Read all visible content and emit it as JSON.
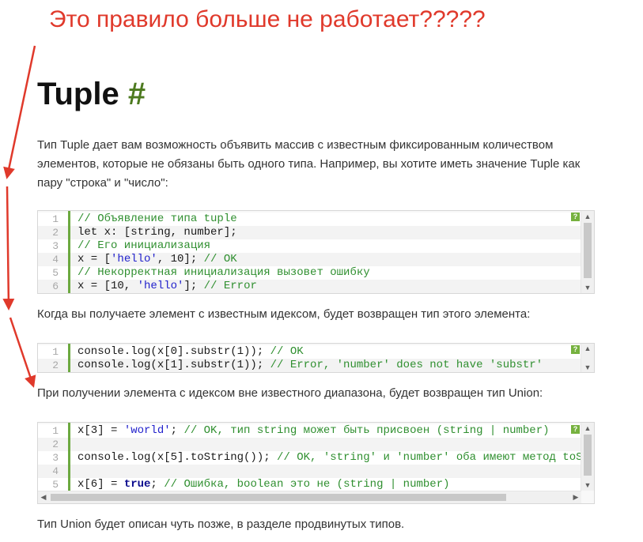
{
  "annotation": {
    "text": "Это правило больше не работает?????",
    "color": "#e0392b"
  },
  "heading": {
    "title": "Tuple",
    "anchor": "#"
  },
  "paragraphs": {
    "intro": "Тип Tuple дает вам возможность объявить массив с известным фиксированным количеством элементов, которые не обязаны быть одного типа. Например, вы хотите иметь значение Tuple как пару \"строка\" и \"число\":",
    "known_index": "Когда вы получаете элемент с известным идексом, будет возвращен тип этого элемента:",
    "out_of_range": "При получении элемента с идексом вне известного диапазона, будет возвращен тип Union:",
    "union_note": "Тип Union будет описан чуть позже, в разделе продвинутых типов."
  },
  "code_blocks": {
    "block1": {
      "lines": [
        {
          "num": "1",
          "tokens": [
            {
              "t": "// Объявление типа tuple",
              "c": "cmt"
            }
          ]
        },
        {
          "num": "2",
          "tokens": [
            {
              "t": "let x: [string, number];",
              "c": ""
            }
          ]
        },
        {
          "num": "3",
          "tokens": [
            {
              "t": "// Его инициализация",
              "c": "cmt"
            }
          ]
        },
        {
          "num": "4",
          "tokens": [
            {
              "t": "x = [",
              "c": ""
            },
            {
              "t": "'hello'",
              "c": "str"
            },
            {
              "t": ", 10]; ",
              "c": ""
            },
            {
              "t": "// OK",
              "c": "cmt"
            }
          ]
        },
        {
          "num": "5",
          "tokens": [
            {
              "t": "// Некорректная инициализация вызовет ошибку",
              "c": "cmt"
            }
          ]
        },
        {
          "num": "6",
          "tokens": [
            {
              "t": "x = [10, ",
              "c": ""
            },
            {
              "t": "'hello'",
              "c": "str"
            },
            {
              "t": "]; ",
              "c": ""
            },
            {
              "t": "// Error",
              "c": "cmt"
            }
          ]
        }
      ]
    },
    "block2": {
      "lines": [
        {
          "num": "1",
          "tokens": [
            {
              "t": "console.log(x[0].substr(1)); ",
              "c": ""
            },
            {
              "t": "// OK",
              "c": "cmt"
            }
          ]
        },
        {
          "num": "2",
          "tokens": [
            {
              "t": "console.log(x[1].substr(1)); ",
              "c": ""
            },
            {
              "t": "// Error, 'number' does not have 'substr'",
              "c": "cmt"
            }
          ]
        }
      ]
    },
    "block3": {
      "lines": [
        {
          "num": "1",
          "tokens": [
            {
              "t": "x[3] = ",
              "c": ""
            },
            {
              "t": "'world'",
              "c": "str"
            },
            {
              "t": "; ",
              "c": ""
            },
            {
              "t": "// OK, тип string может быть присвоен (string | number)",
              "c": "cmt"
            }
          ]
        },
        {
          "num": "2",
          "tokens": [
            {
              "t": "",
              "c": ""
            }
          ]
        },
        {
          "num": "3",
          "tokens": [
            {
              "t": "console.log(x[5].toString()); ",
              "c": ""
            },
            {
              "t": "// OK, 'string' и 'number' оба имеют метод toString",
              "c": "cmt"
            }
          ]
        },
        {
          "num": "4",
          "tokens": [
            {
              "t": "",
              "c": ""
            }
          ]
        },
        {
          "num": "5",
          "tokens": [
            {
              "t": "x[6] = ",
              "c": ""
            },
            {
              "t": "true",
              "c": "kw"
            },
            {
              "t": "; ",
              "c": ""
            },
            {
              "t": "// Ошибка, boolean это не (string | number)",
              "c": "cmt"
            }
          ]
        }
      ]
    }
  },
  "icons": {
    "help": "question-icon",
    "help_glyph": "?",
    "scroll_up": "▲",
    "scroll_down": "▼",
    "scroll_left": "◀",
    "scroll_right": "▶"
  },
  "colors": {
    "anchor_green": "#4d7a1f",
    "gutter_green": "#6ca940",
    "comment": "#2f8f2f",
    "string": "#2222cc",
    "keyword": "#0b0b8e"
  }
}
